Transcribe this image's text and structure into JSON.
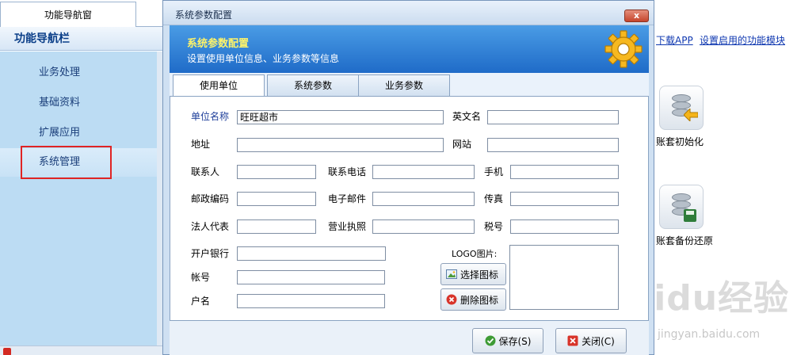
{
  "nav": {
    "tab_label": "功能导航窗",
    "header": "功能导航栏",
    "items": [
      {
        "label": "业务处理"
      },
      {
        "label": "基础资料"
      },
      {
        "label": "扩展应用"
      },
      {
        "label": "系统管理"
      }
    ]
  },
  "right_panel": {
    "links": [
      "下载APP",
      "设置启用的功能模块"
    ],
    "tools": [
      {
        "label": "账套初始化",
        "icon": "database-restore-icon"
      },
      {
        "label": "账套备份还原",
        "icon": "database-backup-icon"
      }
    ],
    "watermark": "Baidu经验",
    "watermark_sub": "jingyan.baidu.com"
  },
  "dialog": {
    "title": "系统参数配置",
    "close_label": "x",
    "banner_title": "系统参数配置",
    "banner_subtitle": "设置使用单位信息、业务参数等信息",
    "tabs": [
      {
        "label": "使用单位",
        "active": true
      },
      {
        "label": "系统参数",
        "active": false
      },
      {
        "label": "业务参数",
        "active": false
      }
    ],
    "fields": {
      "unit_name": {
        "label": "单位名称",
        "value": "旺旺超市"
      },
      "english_name": {
        "label": "英文名",
        "value": ""
      },
      "address": {
        "label": "地址",
        "value": ""
      },
      "website": {
        "label": "网站",
        "value": ""
      },
      "contact": {
        "label": "联系人",
        "value": ""
      },
      "phone": {
        "label": "联系电话",
        "value": ""
      },
      "mobile": {
        "label": "手机",
        "value": ""
      },
      "postcode": {
        "label": "邮政编码",
        "value": ""
      },
      "email": {
        "label": "电子邮件",
        "value": ""
      },
      "fax": {
        "label": "传真",
        "value": ""
      },
      "legal_rep": {
        "label": "法人代表",
        "value": ""
      },
      "license": {
        "label": "营业执照",
        "value": ""
      },
      "tax_no": {
        "label": "税号",
        "value": ""
      },
      "bank": {
        "label": "开户银行",
        "value": ""
      },
      "account": {
        "label": "帐号",
        "value": ""
      },
      "account_name": {
        "label": "户名",
        "value": ""
      }
    },
    "logo_label": "LOGO图片:",
    "select_logo": "选择图标",
    "delete_logo": "删除图标",
    "save": "保存(S)",
    "close": "关闭(C)"
  },
  "colors": {
    "banner": "#2f80d6",
    "banner_title": "#fdf36a",
    "nav_bg": "#bcdcf3",
    "nav_text": "#1a3e7a",
    "highlight": "#e02424",
    "link": "#0e37b0"
  }
}
